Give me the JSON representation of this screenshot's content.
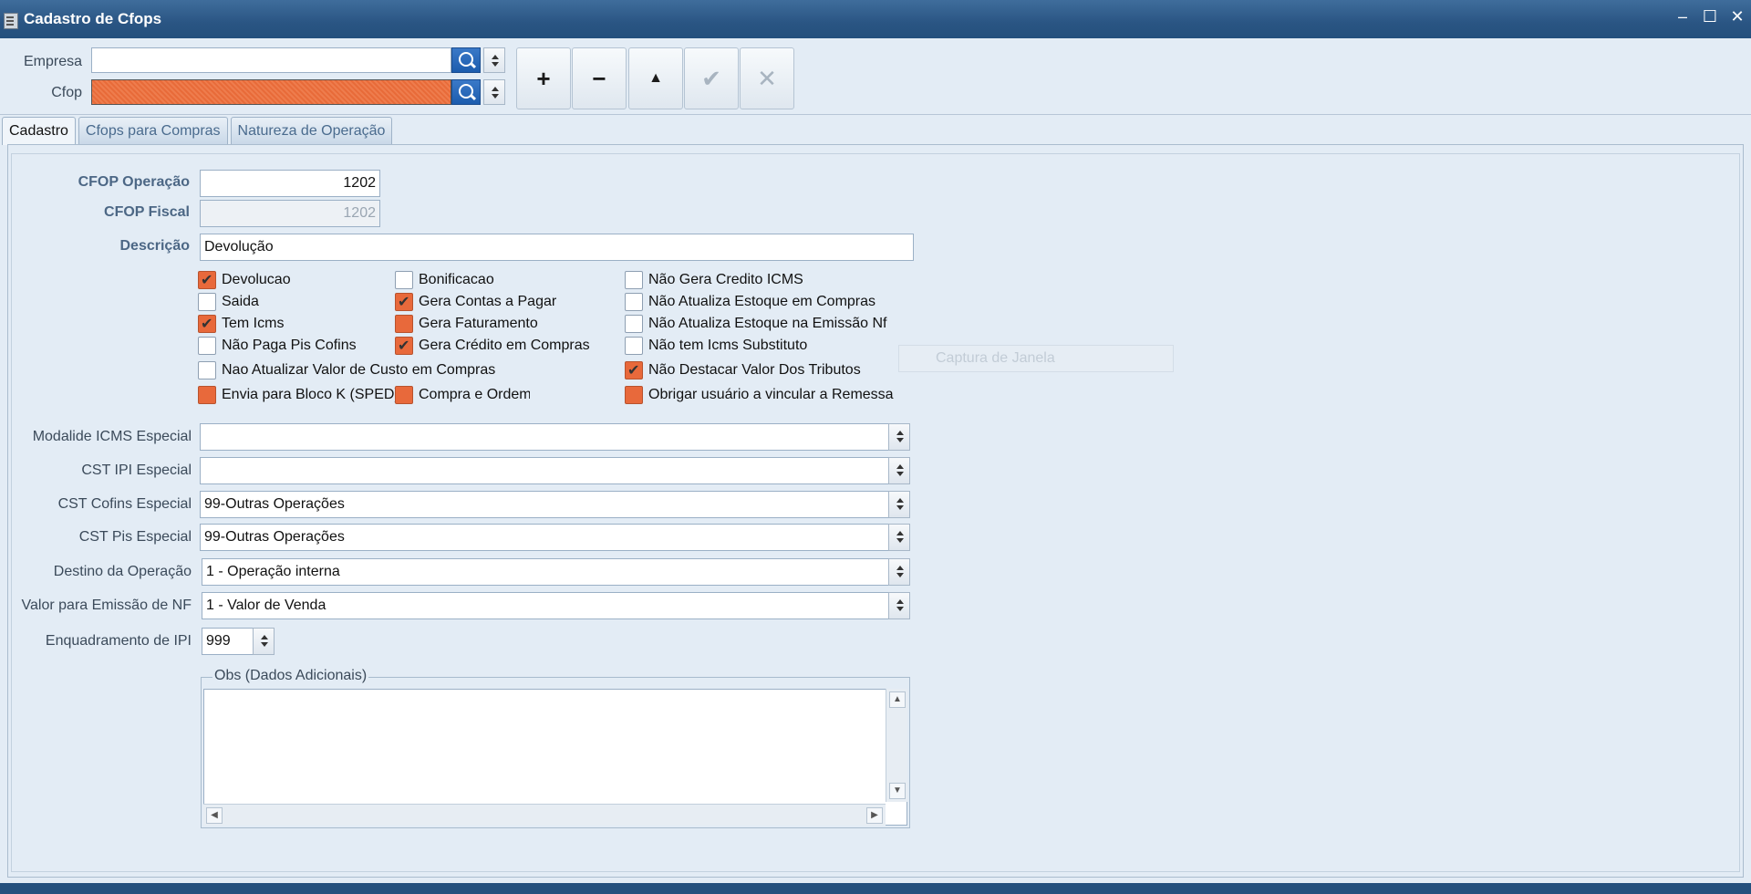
{
  "window": {
    "title": "Cadastro de Cfops",
    "controls": {
      "minimize": "–",
      "maximize": "☐",
      "close": "✕"
    }
  },
  "header": {
    "empresa_label": "Empresa",
    "empresa_value": "",
    "cfop_label": "Cfop",
    "cfop_value": ""
  },
  "nav_buttons": [
    {
      "name": "add",
      "glyph": "+"
    },
    {
      "name": "remove",
      "glyph": "−"
    },
    {
      "name": "up",
      "glyph": "▲"
    },
    {
      "name": "confirm",
      "glyph": "✔"
    },
    {
      "name": "cancel",
      "glyph": "✕"
    }
  ],
  "tabs": [
    {
      "label": "Cadastro",
      "active": true
    },
    {
      "label": "Cfops para Compras",
      "active": false
    },
    {
      "label": "Natureza de Operação",
      "active": false
    }
  ],
  "form": {
    "cfop_operacao_label": "CFOP Operação",
    "cfop_operacao_value": "1202",
    "cfop_fiscal_label": "CFOP Fiscal",
    "cfop_fiscal_value": "1202",
    "descricao_label": "Descrição",
    "descricao_value": "Devolução",
    "checkboxes": [
      {
        "label": "Devolucao",
        "checked": true,
        "highlight": true
      },
      {
        "label": "Bonificacao",
        "checked": false,
        "highlight": false
      },
      {
        "label": "Não Gera Credito ICMS",
        "checked": false,
        "highlight": false
      },
      {
        "label": "Saida",
        "checked": false,
        "highlight": false
      },
      {
        "label": "Gera Contas a Pagar",
        "checked": true,
        "highlight": true
      },
      {
        "label": "Não Atualiza Estoque em Compras",
        "checked": false,
        "highlight": false
      },
      {
        "label": "Tem Icms",
        "checked": true,
        "highlight": true
      },
      {
        "label": "Gera Faturamento",
        "checked": false,
        "highlight": true
      },
      {
        "label": "Não Atualiza Estoque na Emissão Nf",
        "checked": false,
        "highlight": false
      },
      {
        "label": "Não Paga Pis Cofins",
        "checked": false,
        "highlight": false
      },
      {
        "label": "Gera Crédito em Compras",
        "checked": true,
        "highlight": true
      },
      {
        "label": "Não tem Icms Substituto",
        "checked": false,
        "highlight": false
      },
      {
        "label": "Nao Atualizar Valor de Custo em Compras",
        "checked": false,
        "highlight": false
      },
      {
        "label": "Não Destacar Valor Dos Tributos",
        "checked": true,
        "highlight": true
      },
      {
        "label": "Envia para Bloco K (SPED)",
        "checked": false,
        "highlight": true
      },
      {
        "label": "Compra e Ordem",
        "checked": false,
        "highlight": true
      },
      {
        "label": "Obrigar usuário a vincular a Remessa",
        "checked": false,
        "highlight": true
      }
    ],
    "selects": [
      {
        "label": "Modalide ICMS Especial",
        "value": ""
      },
      {
        "label": "CST IPI Especial",
        "value": ""
      },
      {
        "label": "CST Cofins Especial",
        "value": "99-Outras Operações"
      },
      {
        "label": "CST Pis Especial",
        "value": "99-Outras Operações"
      },
      {
        "label": "Destino da Operação",
        "value": "1 - Operação interna"
      },
      {
        "label": "Valor para Emissão de NF",
        "value": "1 - Valor de Venda"
      }
    ],
    "enquadramento_label": "Enquadramento de IPI",
    "enquadramento_value": "999",
    "obs_label": "Obs (Dados Adicionais)",
    "obs_value": ""
  },
  "overlay": {
    "text": "Captura de Janela"
  },
  "colors": {
    "titlebar": "#2a5583",
    "highlight": "#e8693b",
    "background": "#e3ecf5"
  }
}
